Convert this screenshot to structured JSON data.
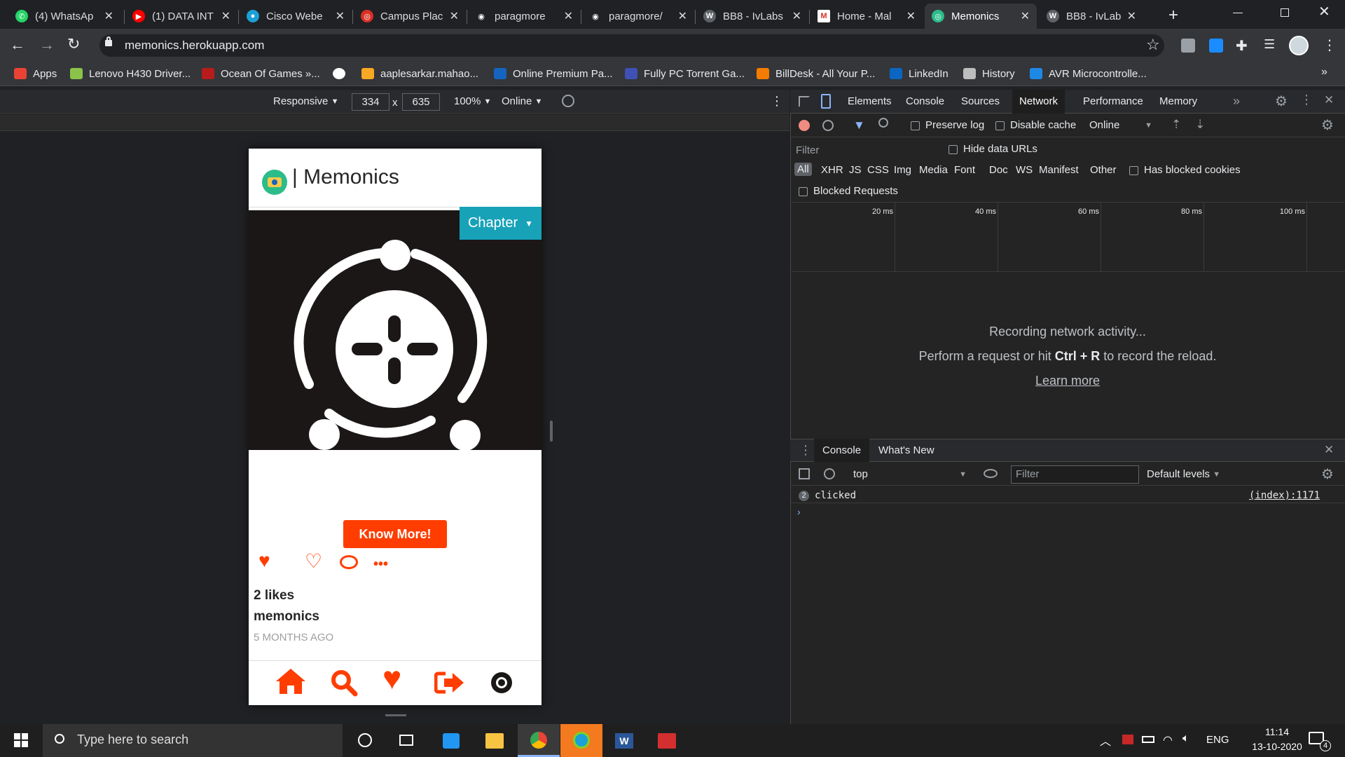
{
  "browser": {
    "tabs": [
      {
        "title": "(4) WhatsAp",
        "color": "#25d366",
        "glyph": "✆"
      },
      {
        "title": "(1) DATA INT",
        "color": "#ff0000",
        "glyph": "▶"
      },
      {
        "title": "Cisco Webe",
        "color": "#1ba0d7",
        "glyph": "●"
      },
      {
        "title": "Campus Plac",
        "color": "#d93025",
        "glyph": "◎"
      },
      {
        "title": "paragmore",
        "color": "#202124",
        "glyph": "◉"
      },
      {
        "title": "paragmore/",
        "color": "#202124",
        "glyph": "◉"
      },
      {
        "title": "BB8 - IvLabs",
        "color": "#5f6368",
        "glyph": "W"
      },
      {
        "title": "Home - Mal",
        "color": "#fff",
        "glyph": "M"
      },
      {
        "title": "Memonics",
        "color": "#2bbc8a",
        "glyph": "◎"
      },
      {
        "title": "BB8 - IvLabs",
        "color": "#5f6368",
        "glyph": "W"
      }
    ],
    "url": "memonics.herokuapp.com",
    "bookmarks": [
      {
        "label": "Apps",
        "color": "#ea4335"
      },
      {
        "label": "Lenovo H430 Driver...",
        "color": "#8bc34a"
      },
      {
        "label": "Ocean Of Games »...",
        "color": "#b71c1c"
      },
      {
        "label": "",
        "color": "#ffffff"
      },
      {
        "label": "aaplesarkar.mahao...",
        "color": "#f9a825"
      },
      {
        "label": "Online Premium Pa...",
        "color": "#1565c0"
      },
      {
        "label": "Fully PC Torrent Ga...",
        "color": "#3f51b5"
      },
      {
        "label": "BillDesk - All Your P...",
        "color": "#f57c00"
      },
      {
        "label": "LinkedIn",
        "color": "#0a66c2"
      },
      {
        "label": "History",
        "color": "#bdbdbd"
      },
      {
        "label": "AVR Microcontrolle...",
        "color": "#1e88e5"
      }
    ]
  },
  "emulator": {
    "mode": "Responsive",
    "width": "334",
    "height": "635",
    "zoom": "100%",
    "throttle": "Online"
  },
  "app": {
    "title": "| Memonics",
    "chapter_label": "Chapter",
    "know_more": "Know More!",
    "likes": "2 likes",
    "username": "memonics",
    "timestamp": "5 MONTHS AGO",
    "colors": {
      "accent": "#ff3d00",
      "chapter": "#17a2b8"
    }
  },
  "devtools": {
    "tabs": [
      "Elements",
      "Console",
      "Sources",
      "Network",
      "Performance",
      "Memory"
    ],
    "active_tab": "Network",
    "preserve_log": "Preserve log",
    "disable_cache": "Disable cache",
    "throttle": "Online",
    "filter_placeholder": "Filter",
    "hide_data_urls": "Hide data URLs",
    "types": [
      "All",
      "XHR",
      "JS",
      "CSS",
      "Img",
      "Media",
      "Font",
      "Doc",
      "WS",
      "Manifest",
      "Other"
    ],
    "has_blocked_cookies": "Has blocked cookies",
    "blocked_requests": "Blocked Requests",
    "timeline": [
      "20 ms",
      "40 ms",
      "60 ms",
      "80 ms",
      "100 ms"
    ],
    "empty_line1": "Recording network activity...",
    "empty_pre": "Perform a request or hit ",
    "empty_keys": "Ctrl + R",
    "empty_post": " to record the reload.",
    "learn_more": "Learn more",
    "drawer_tabs": [
      "Console",
      "What's New"
    ],
    "context": "top",
    "console_filter": "Filter",
    "levels": "Default levels",
    "log_count": "2",
    "log_message": "clicked",
    "log_source": "(index):1171"
  },
  "taskbar": {
    "search_placeholder": "Type here to search",
    "lang": "ENG",
    "time": "11:14",
    "date": "13-10-2020",
    "notif_count": "4"
  }
}
